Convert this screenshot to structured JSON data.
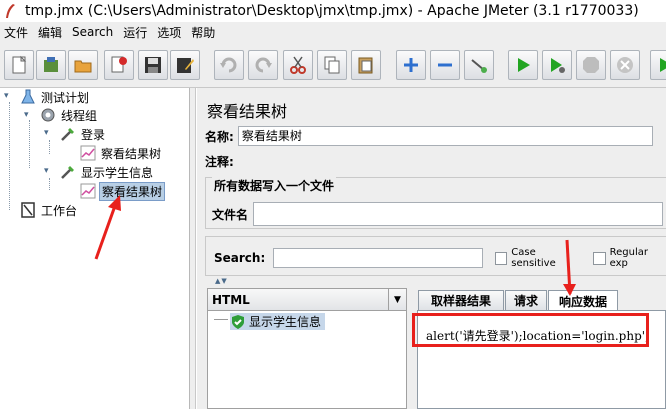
{
  "window": {
    "title": "tmp.jmx (C:\\Users\\Administrator\\Desktop\\jmx\\tmp.jmx) - Apache JMeter (3.1 r1770033)"
  },
  "menu": [
    "文件",
    "编辑",
    "Search",
    "运行",
    "选项",
    "帮助"
  ],
  "toolbar": {
    "buttons": [
      "new-icon",
      "templates-icon",
      "open-icon",
      "close-icon",
      "save-icon",
      "save-as-icon",
      "undo-icon",
      "redo-icon",
      "cut-icon",
      "copy-icon",
      "paste-icon",
      "expand-icon",
      "collapse-icon",
      "toggle-icon",
      "start-icon",
      "start-no-pause-icon",
      "stop-icon",
      "shutdown-icon",
      "remote-start-icon"
    ]
  },
  "tree": {
    "nodes": [
      {
        "label": "测试计划",
        "icon": "test-plan-icon"
      },
      {
        "label": "线程组",
        "icon": "thread-group-icon"
      },
      {
        "label": "登录",
        "icon": "sampler-icon"
      },
      {
        "label": "察看结果树",
        "icon": "listener-icon"
      },
      {
        "label": "显示学生信息",
        "icon": "sampler-icon"
      },
      {
        "label": "察看结果树",
        "icon": "listener-icon",
        "selected": true
      },
      {
        "label": "工作台",
        "icon": "workbench-icon"
      }
    ]
  },
  "panel": {
    "title": "察看结果树",
    "name_label": "名称:",
    "name_value": "察看结果树",
    "comment_label": "注释:",
    "comment_value": "",
    "file_group_title": "所有数据写入一个文件",
    "filename_label": "文件名",
    "filename_value": ""
  },
  "search": {
    "label": "Search:",
    "value": "",
    "case_sensitive_label": "Case sensitive",
    "regular_exp_label": "Regular exp"
  },
  "results": {
    "renderer": "HTML",
    "items": [
      {
        "label": "显示学生信息",
        "status": "success"
      }
    ],
    "tabs": [
      "取样器结果",
      "请求",
      "响应数据"
    ],
    "active_tab": 2,
    "response_text": "alert('请先登录');location='login.php';"
  },
  "colors": {
    "annotation_red": "#e8201c",
    "selection": "#b8cfe5",
    "panel_bg": "#eeeeee"
  }
}
